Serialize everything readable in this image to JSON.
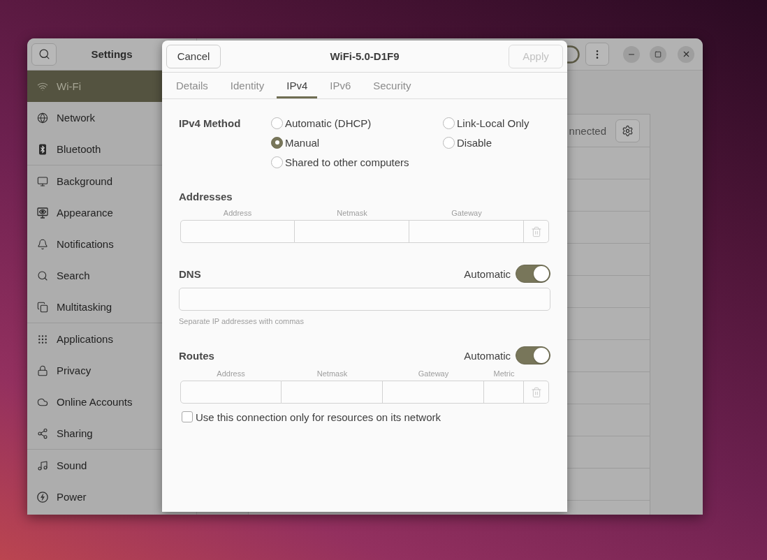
{
  "window": {
    "title": "Settings"
  },
  "sidebar": {
    "groups": [
      [
        {
          "label": "Wi-Fi",
          "selected": true
        },
        {
          "label": "Network",
          "selected": false
        },
        {
          "label": "Bluetooth",
          "selected": false
        }
      ],
      [
        {
          "label": "Background",
          "selected": false
        },
        {
          "label": "Appearance",
          "selected": false
        },
        {
          "label": "Notifications",
          "selected": false
        },
        {
          "label": "Search",
          "selected": false
        },
        {
          "label": "Multitasking",
          "selected": false
        }
      ],
      [
        {
          "label": "Applications",
          "selected": false
        },
        {
          "label": "Privacy",
          "selected": false
        },
        {
          "label": "Online Accounts",
          "selected": false
        },
        {
          "label": "Sharing",
          "selected": false
        }
      ],
      [
        {
          "label": "Sound",
          "selected": false
        },
        {
          "label": "Power",
          "selected": false
        }
      ]
    ]
  },
  "network_list": {
    "status": "nnected"
  },
  "dialog": {
    "title": "WiFi-5.0-D1F9",
    "cancel_button": "Cancel",
    "apply_button": {
      "label": "Apply",
      "disabled": true
    },
    "tabs": [
      {
        "label": "Details",
        "selected": false
      },
      {
        "label": "Identity",
        "selected": false
      },
      {
        "label": "IPv4",
        "selected": true
      },
      {
        "label": "IPv6",
        "selected": false
      },
      {
        "label": "Security",
        "selected": false
      }
    ],
    "ipv4_method": {
      "label": "IPv4 Method",
      "options": [
        {
          "label": "Automatic (DHCP)",
          "selected": false
        },
        {
          "label": "Manual",
          "selected": true
        },
        {
          "label": "Shared to other computers",
          "selected": false
        },
        {
          "label": "Link-Local Only",
          "selected": false
        },
        {
          "label": "Disable",
          "selected": false
        }
      ]
    },
    "addresses": {
      "heading": "Addresses",
      "columns": [
        "Address",
        "Netmask",
        "Gateway"
      ]
    },
    "dns": {
      "heading": "DNS",
      "automatic_label": "Automatic",
      "automatic": true,
      "hint": "Separate IP addresses with commas"
    },
    "routes": {
      "heading": "Routes",
      "automatic_label": "Automatic",
      "automatic": true,
      "columns": [
        "Address",
        "Netmask",
        "Gateway",
        "Metric"
      ]
    },
    "limit_to_network": {
      "label": "Use this connection only for resources on its network",
      "checked": false
    }
  }
}
